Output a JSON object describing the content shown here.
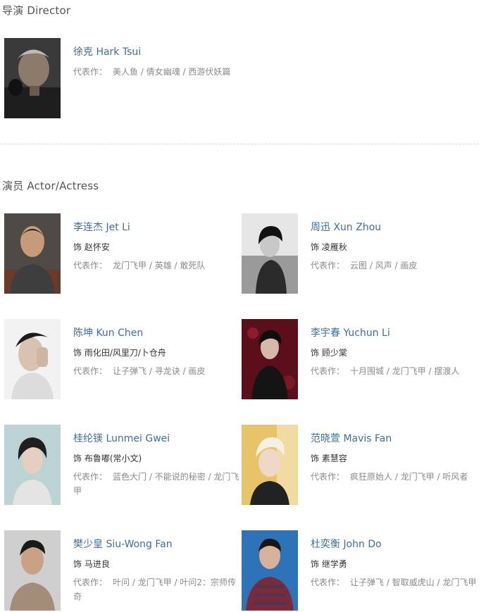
{
  "director_section": {
    "title": "导演 Director"
  },
  "actor_section": {
    "title": "演员 Actor/Actress"
  },
  "director": {
    "name": "徐克 Hark Tsui",
    "works_label": "代表作：",
    "works": "美人鱼 / 倩女幽魂 / 西游伏妖篇"
  },
  "actors": [
    {
      "name": "李连杰 Jet Li",
      "role": "饰 赵怀安",
      "works_label": "代表作：",
      "works": "龙门飞甲 / 英雄 / 敢死队"
    },
    {
      "name": "周迅 Xun Zhou",
      "role": "饰 凌雁秋",
      "works_label": "代表作：",
      "works": "云图 / 风声 / 画皮"
    },
    {
      "name": "陈坤 Kun Chen",
      "role": "饰 雨化田/风里刀/卜仓舟",
      "works_label": "代表作：",
      "works": "让子弹飞 / 寻龙诀 / 画皮"
    },
    {
      "name": "李宇春 Yuchun Li",
      "role": "饰 顾少棠",
      "works_label": "代表作：",
      "works": "十月围城 / 龙门飞甲 / 摆渡人"
    },
    {
      "name": "桂纶镁 Lunmei Gwei",
      "role": "饰 布鲁嘟(常小文)",
      "works_label": "代表作：",
      "works": "蓝色大门 / 不能说的秘密 / 龙门飞甲"
    },
    {
      "name": "范晓萱 Mavis Fan",
      "role": "饰 素慧容",
      "works_label": "代表作：",
      "works": "疯狂原始人 / 龙门飞甲 / 听风者"
    },
    {
      "name": "樊少皇 Siu-Wong Fan",
      "role": "饰 马进良",
      "works_label": "代表作：",
      "works": "叶问 / 龙门飞甲 / 叶问2：宗师传奇"
    },
    {
      "name": "杜奕衡 John Do",
      "role": "饰 继学勇",
      "works_label": "代表作：",
      "works": "让子弹飞 / 智取威虎山 / 龙门飞甲"
    }
  ],
  "colors": {
    "link": "#3f6e99",
    "muted": "#8a8a8a",
    "divider": "#d8d8d8"
  }
}
